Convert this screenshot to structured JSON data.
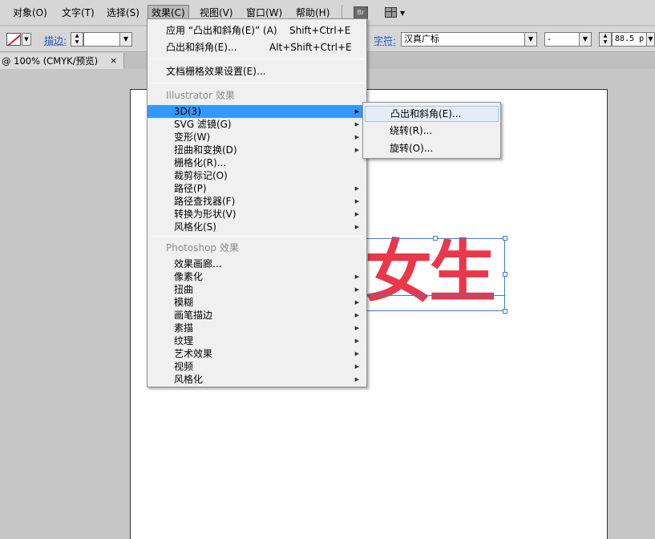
{
  "menubar": {
    "items": [
      "对象(O)",
      "文字(T)",
      "选择(S)",
      "效果(C)",
      "视图(V)",
      "窗口(W)",
      "帮助(H)"
    ],
    "bridge_label": "Br"
  },
  "controlbar": {
    "stroke_label": "描边:",
    "char_label": "字符:",
    "font_family": "汉真广标",
    "font_style": "-",
    "font_size": "88.5 p"
  },
  "document_tab": {
    "title": "@ 100% (CMYK/预览)",
    "close_glyph": "×"
  },
  "canvas": {
    "art_text": "女生",
    "art_color": "#e8384a"
  },
  "effect_menu": {
    "apply_last": "应用 “凸出和斜角(E)” (A)",
    "apply_last_shortcut": "Shift+Ctrl+E",
    "last_effect": "凸出和斜角(E)...",
    "last_effect_shortcut": "Alt+Shift+Ctrl+E",
    "raster_settings": "文档栅格效果设置(E)...",
    "illustrator_header": "Illustrator 效果",
    "illustrator_items": [
      "3D(3)",
      "SVG 滤镜(G)",
      "变形(W)",
      "扭曲和变换(D)",
      "栅格化(R)...",
      "裁剪标记(O)",
      "路径(P)",
      "路径查找器(F)",
      "转换为形状(V)",
      "风格化(S)"
    ],
    "photoshop_header": "Photoshop 效果",
    "photoshop_items": [
      "效果画廊...",
      "像素化",
      "扭曲",
      "模糊",
      "画笔描边",
      "素描",
      "纹理",
      "艺术效果",
      "视频",
      "风格化"
    ]
  },
  "submenu_3d": {
    "items": [
      "凸出和斜角(E)...",
      "绕转(R)...",
      "旋转(O)..."
    ]
  },
  "colors": {
    "highlight": "#3399ff",
    "menu_bg": "#f0f0f0",
    "app_bg": "#c6c6c6"
  }
}
